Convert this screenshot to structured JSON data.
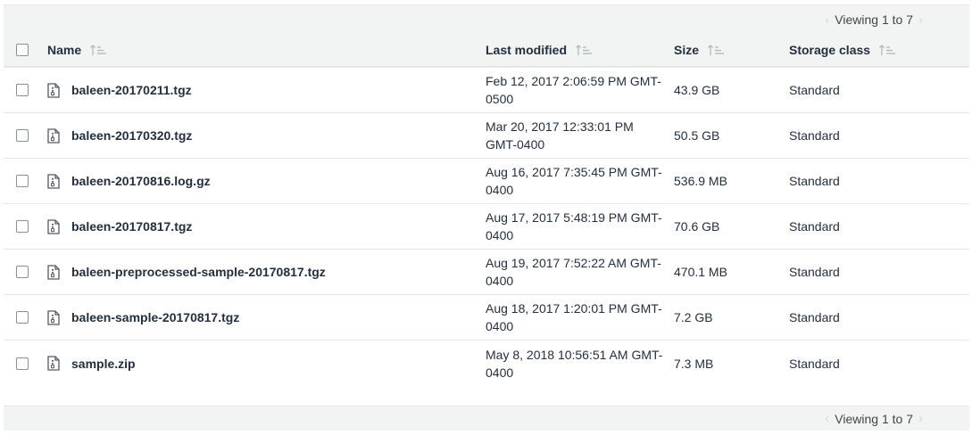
{
  "pager": {
    "viewing_text": "Viewing 1 to 7",
    "prev_icon": "chevron-left-icon",
    "next_icon": "chevron-right-icon"
  },
  "table": {
    "columns": [
      {
        "label": "Name",
        "icon": "sort-icon"
      },
      {
        "label": "Last modified",
        "icon": "sort-icon"
      },
      {
        "label": "Size",
        "icon": "sort-icon"
      },
      {
        "label": "Storage class",
        "icon": "sort-icon"
      }
    ],
    "rows": [
      {
        "name": "baleen-20170211.tgz",
        "modified": "Feb 12, 2017 2:06:59 PM GMT-0500",
        "size": "43.9 GB",
        "storage_class": "Standard"
      },
      {
        "name": "baleen-20170320.tgz",
        "modified": "Mar 20, 2017 12:33:01 PM GMT-0400",
        "size": "50.5 GB",
        "storage_class": "Standard"
      },
      {
        "name": "baleen-20170816.log.gz",
        "modified": "Aug 16, 2017 7:35:45 PM GMT-0400",
        "size": "536.9 MB",
        "storage_class": "Standard"
      },
      {
        "name": "baleen-20170817.tgz",
        "modified": "Aug 17, 2017 5:48:19 PM GMT-0400",
        "size": "70.6 GB",
        "storage_class": "Standard"
      },
      {
        "name": "baleen-preprocessed-sample-20170817.tgz",
        "modified": "Aug 19, 2017 7:52:22 AM GMT-0400",
        "size": "470.1 MB",
        "storage_class": "Standard"
      },
      {
        "name": "baleen-sample-20170817.tgz",
        "modified": "Aug 18, 2017 1:20:01 PM GMT-0400",
        "size": "7.2 GB",
        "storage_class": "Standard"
      },
      {
        "name": "sample.zip",
        "modified": "May 8, 2018 10:56:51 AM GMT-0400",
        "size": "7.3 MB",
        "storage_class": "Standard"
      }
    ]
  },
  "icons": {
    "file": "zip-file-icon",
    "checkbox": "checkbox"
  },
  "colors": {
    "header_bg": "#f2f3f3",
    "text": "#232f3e",
    "border": "#e6e7e7",
    "pager_arrow": "#d5d9d9"
  }
}
